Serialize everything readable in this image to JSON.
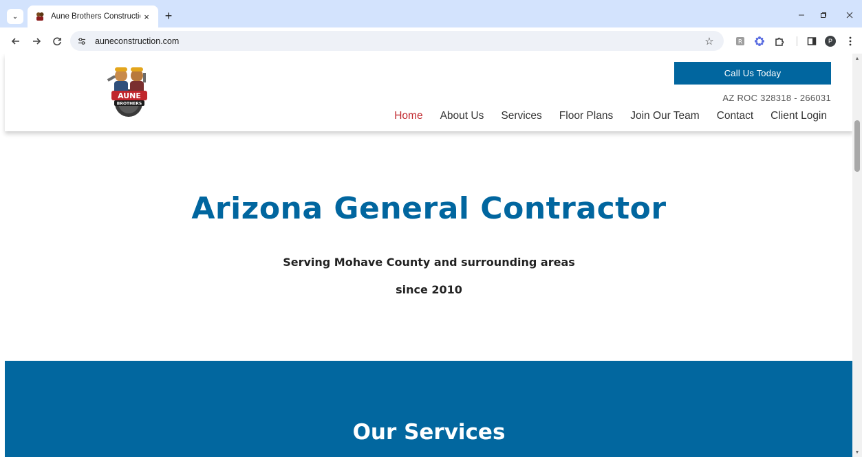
{
  "browser": {
    "tab_title": "Aune Brothers Construction",
    "tab_close_glyph": "×",
    "new_tab_glyph": "+",
    "url": "auneconstruction.com",
    "avatar_initial": "P"
  },
  "icons": {
    "tab_menu": "chevron-down-icon",
    "favicon": "aune-brothers-favicon",
    "back": "arrow-left-icon",
    "forward": "arrow-right-icon",
    "reload": "reload-icon",
    "site_info": "tune-icon",
    "bookmark": "star-icon",
    "extensions": [
      "r-extension-icon",
      "gear-flower-extension-icon",
      "puzzle-piece-icon"
    ],
    "side_panel": "side-panel-icon",
    "menu": "kebab-menu-icon"
  },
  "header": {
    "cta_label": "Call Us Today",
    "license": "AZ ROC 328318 - 266031",
    "nav": [
      "Home",
      "About Us",
      "Services",
      "Floor Plans",
      "Join Our Team",
      "Contact",
      "Client Login"
    ],
    "active_nav": "Home",
    "logo_text_top": "AUNE",
    "logo_text_bottom": "BROTHERS"
  },
  "hero": {
    "title": "Arizona General Contractor",
    "subtitle_line1": "Serving Mohave County and surrounding areas",
    "subtitle_line2": "since 2010"
  },
  "services": {
    "title": "Our Services"
  },
  "colors": {
    "brand_blue": "#01669f",
    "active_red": "#c0262c",
    "tabstrip": "#d3e3fd"
  }
}
